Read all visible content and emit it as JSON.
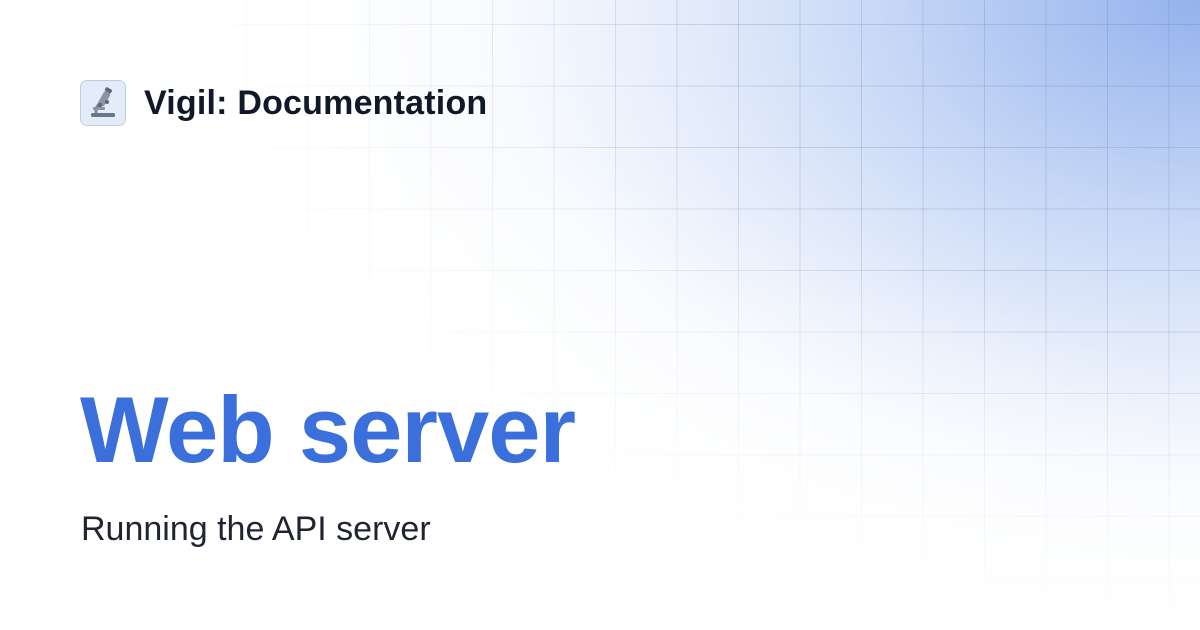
{
  "brand": {
    "logo_icon": "microscope-icon",
    "name": "Vigil: Documentation"
  },
  "page": {
    "title": "Web server",
    "subtitle": "Running the API server"
  },
  "colors": {
    "title": "#3a6fdc",
    "text": "#111827",
    "gradient": "#8eaeec"
  }
}
